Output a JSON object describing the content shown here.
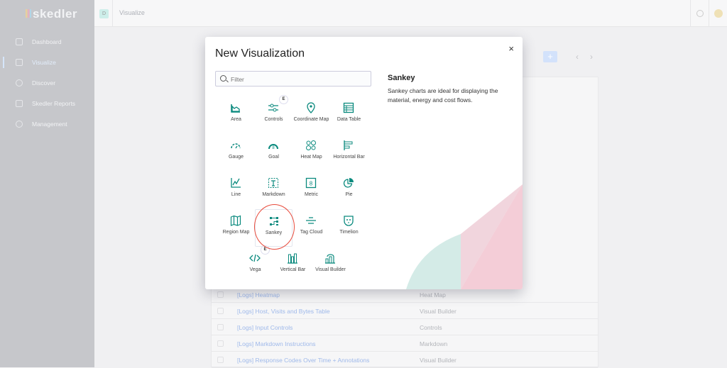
{
  "app": {
    "logo": "skedler"
  },
  "sidebar": {
    "items": [
      {
        "label": "Dashboard",
        "icon": "dashboard-icon"
      },
      {
        "label": "Visualize",
        "icon": "visualize-icon",
        "active": true
      },
      {
        "label": "Discover",
        "icon": "compass-icon"
      },
      {
        "label": "Skedler Reports",
        "icon": "chart-icon"
      },
      {
        "label": "Management",
        "icon": "gear-icon"
      }
    ]
  },
  "header": {
    "badge": "D",
    "title": "Visualize"
  },
  "toolbar": {
    "add_label": "+",
    "prev": "‹",
    "next": "›"
  },
  "table": {
    "rows": [
      {
        "title": "[Logs] Heatmap",
        "type": "Heat Map"
      },
      {
        "title": "[Logs] Host, Visits and Bytes Table",
        "type": "Visual Builder"
      },
      {
        "title": "[Logs] Input Controls",
        "type": "Controls"
      },
      {
        "title": "[Logs] Markdown Instructions",
        "type": "Markdown"
      },
      {
        "title": "[Logs] Response Codes Over Time + Annotations",
        "type": "Visual Builder"
      }
    ]
  },
  "modal": {
    "title": "New Visualization",
    "close": "×",
    "filter_placeholder": "Filter",
    "selected": {
      "title": "Sankey",
      "description": "Sankey charts are ideal for displaying the material, energy and cost flows."
    },
    "types": [
      {
        "label": "Area",
        "icon": "area-chart-icon"
      },
      {
        "label": "Controls",
        "icon": "sliders-icon",
        "badge": "E"
      },
      {
        "label": "Coordinate Map",
        "icon": "map-pin-icon"
      },
      {
        "label": "Data Table",
        "icon": "table-icon"
      },
      {
        "label": "Gauge",
        "icon": "gauge-icon"
      },
      {
        "label": "Goal",
        "icon": "goal-icon"
      },
      {
        "label": "Heat Map",
        "icon": "heatmap-icon"
      },
      {
        "label": "Horizontal Bar",
        "icon": "horizontal-bar-icon"
      },
      {
        "label": "Line",
        "icon": "line-chart-icon"
      },
      {
        "label": "Markdown",
        "icon": "markdown-icon"
      },
      {
        "label": "Metric",
        "icon": "metric-icon"
      },
      {
        "label": "Pie",
        "icon": "pie-chart-icon"
      },
      {
        "label": "Region Map",
        "icon": "region-map-icon"
      },
      {
        "label": "Sankey",
        "icon": "sankey-icon"
      },
      {
        "label": "Tag Cloud",
        "icon": "tag-cloud-icon"
      },
      {
        "label": "Timelion",
        "icon": "timelion-icon"
      },
      {
        "label": "Vega",
        "icon": "code-icon",
        "badge": "E"
      },
      {
        "label": "Vertical Bar",
        "icon": "vertical-bar-icon"
      },
      {
        "label": "Visual Builder",
        "icon": "visual-builder-icon"
      }
    ]
  },
  "colors": {
    "accent": "#0b8a7e",
    "primary": "#3b82f6",
    "highlight_ring": "#e84b3c"
  }
}
